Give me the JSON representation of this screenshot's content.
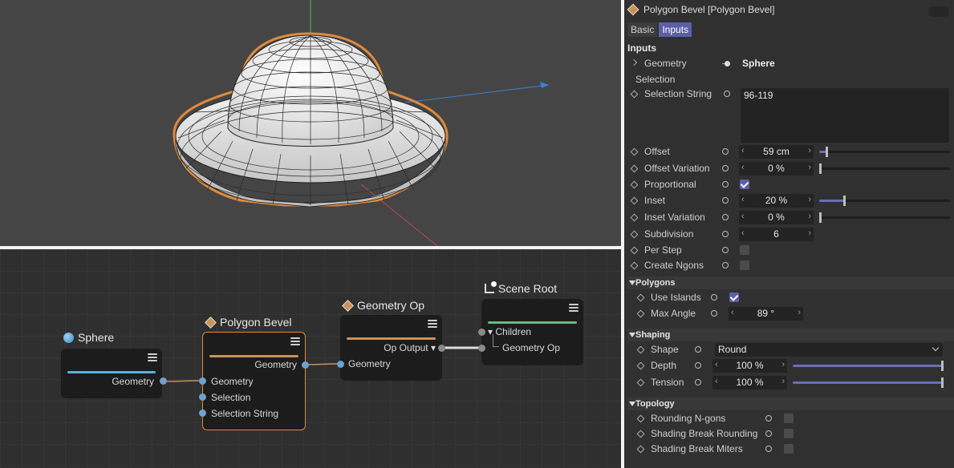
{
  "node_editor": {
    "nodes": {
      "sphere": {
        "title": "Sphere",
        "outputs": [
          "Geometry"
        ]
      },
      "polygon_bevel": {
        "title": "Polygon Bevel",
        "outputs": [
          "Geometry"
        ],
        "inputs": [
          "Geometry",
          "Selection",
          "Selection String"
        ]
      },
      "geometry_op": {
        "title": "Geometry Op",
        "outputs": [
          "Op Output ▾"
        ],
        "inputs": [
          "Geometry"
        ]
      },
      "scene_root": {
        "title": "Scene Root",
        "inputs": [
          "▾ Children",
          "Geometry Op"
        ]
      }
    }
  },
  "panel": {
    "title": "Polygon Bevel [Polygon Bevel]",
    "tabs": [
      "Basic",
      "Inputs"
    ],
    "active_tab": "Inputs",
    "group_title": "Inputs",
    "geometry": {
      "label": "Geometry",
      "value": "Sphere"
    },
    "selection_label": "Selection",
    "selection_string": {
      "label": "Selection String",
      "value": "96-119"
    },
    "offset": {
      "label": "Offset",
      "value": "59 cm",
      "slider": 0.07
    },
    "offset_variation": {
      "label": "Offset Variation",
      "value": "0 %",
      "slider": 0.0
    },
    "proportional": {
      "label": "Proportional",
      "checked": true
    },
    "inset": {
      "label": "Inset",
      "value": "20 %",
      "slider": 0.2
    },
    "inset_variation": {
      "label": "Inset Variation",
      "value": "0 %",
      "slider": 0.0
    },
    "subdivision": {
      "label": "Subdivision",
      "value": "6"
    },
    "per_step": {
      "label": "Per Step",
      "checked": false
    },
    "create_ngons": {
      "label": "Create Ngons",
      "checked": false
    },
    "polygons_section": "Polygons",
    "use_islands": {
      "label": "Use Islands",
      "checked": true
    },
    "max_angle": {
      "label": "Max Angle",
      "value": "89 °"
    },
    "shaping_section": "Shaping",
    "shape": {
      "label": "Shape",
      "value": "Round"
    },
    "depth": {
      "label": "Depth",
      "value": "100 %",
      "slider": 1.0
    },
    "tension": {
      "label": "Tension",
      "value": "100 %",
      "slider": 1.0
    },
    "topology_section": "Topology",
    "rounding_ngons": {
      "label": "Rounding N-gons",
      "checked": false
    },
    "shading_break_rounding": {
      "label": "Shading Break Rounding",
      "checked": false
    },
    "shading_break_miters": {
      "label": "Shading Break Miters",
      "checked": false
    }
  },
  "colors": {
    "accent": "#5b5fa8",
    "selection_outline": "#e08a3c",
    "sphere_bar": "#5ab0d8",
    "bevel_bar": "#c8925a",
    "root_bar": "#5cc080",
    "port": "#6fa0d0"
  }
}
